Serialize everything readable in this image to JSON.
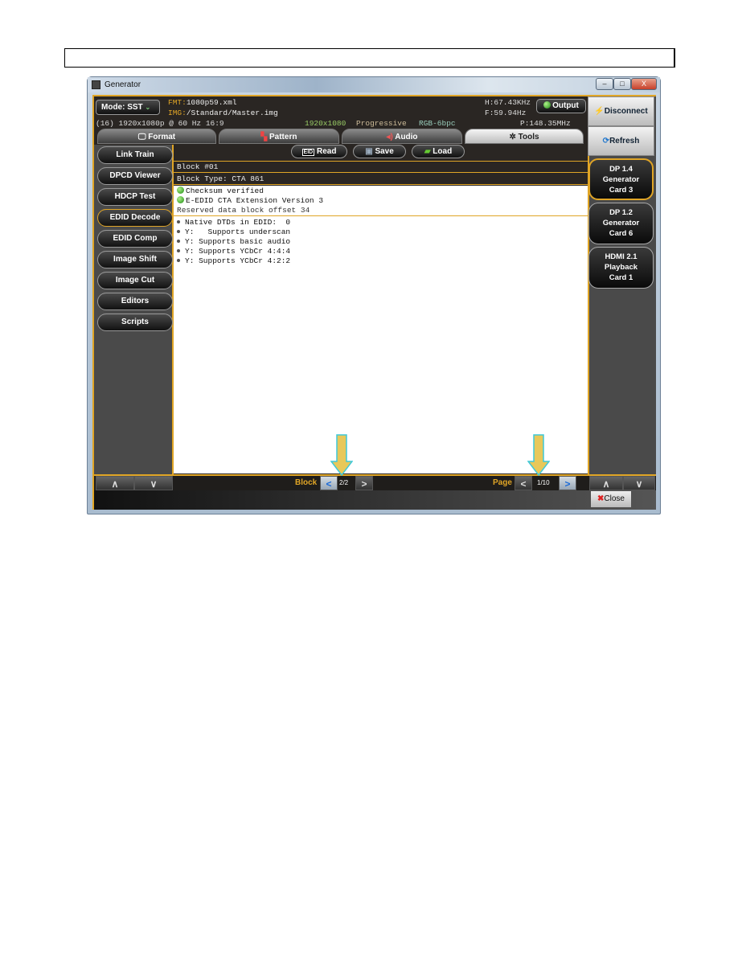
{
  "window": {
    "title": "Generator",
    "minimize": "–",
    "maximize": "□",
    "close": "X"
  },
  "header": {
    "mode": "Mode: SST",
    "fmt_label": "FMT:",
    "fmt_value": "1080p59.xml",
    "img_label": "IMG:",
    "img_value": "/Standard/Master.img",
    "h_freq": "H:67.43KHz",
    "f_freq": "F:59.94Hz",
    "output": "Output",
    "timing": "(16) 1920x1080p @ 60 Hz 16:9",
    "resolution": "1920x1080",
    "scan": "Progressive",
    "color": "RGB-6bpc",
    "pixel_clock": "P:148.35MHz"
  },
  "tabs": [
    {
      "label": "Format"
    },
    {
      "label": "Pattern"
    },
    {
      "label": "Audio"
    },
    {
      "label": "Tools",
      "active": true
    }
  ],
  "sidebar": {
    "items": [
      {
        "label": "Link Train"
      },
      {
        "label": "DPCD Viewer"
      },
      {
        "label": "HDCP Test"
      },
      {
        "label": "EDID Decode",
        "selected": true
      },
      {
        "label": "EDID Comp"
      },
      {
        "label": "Image Shift"
      },
      {
        "label": "Image Cut"
      },
      {
        "label": "Editors"
      },
      {
        "label": "Scripts"
      }
    ]
  },
  "toolbar": {
    "read": "Read",
    "save": "Save",
    "load": "Load"
  },
  "content": {
    "block_number": "Block #01",
    "block_type": "Block Type: CTA 861",
    "status": [
      "Checksum verified",
      "E-EDID CTA Extension Version 3"
    ],
    "note": "Reserved data block offset 34",
    "items": [
      "Native DTDs in EDID:  0",
      "Y:   Supports underscan",
      "Y: Supports basic audio",
      "Y: Supports YCbCr 4:4:4",
      "Y: Supports YCbCr 4:2:2"
    ]
  },
  "right": {
    "disconnect": "Disconnect",
    "refresh": "Refresh",
    "cards": [
      {
        "l1": "DP 1.4",
        "l2": "Generator",
        "l3": "Card 3",
        "selected": true
      },
      {
        "l1": "DP 1.2",
        "l2": "Generator",
        "l3": "Card 6"
      },
      {
        "l1": "HDMI 2.1",
        "l2": "Playback",
        "l3": "Card 1"
      }
    ]
  },
  "nav": {
    "block_label": "Block",
    "block_value": "2/2",
    "page_label": "Page",
    "page_value": "1/10",
    "up": "∧",
    "down": "∨",
    "prev": "<",
    "next": ">"
  },
  "footer": {
    "close": "Close"
  },
  "colors": {
    "accent": "#e0a526",
    "arrow": "#e8c85a",
    "arrow_outline": "#3fc8d8"
  }
}
